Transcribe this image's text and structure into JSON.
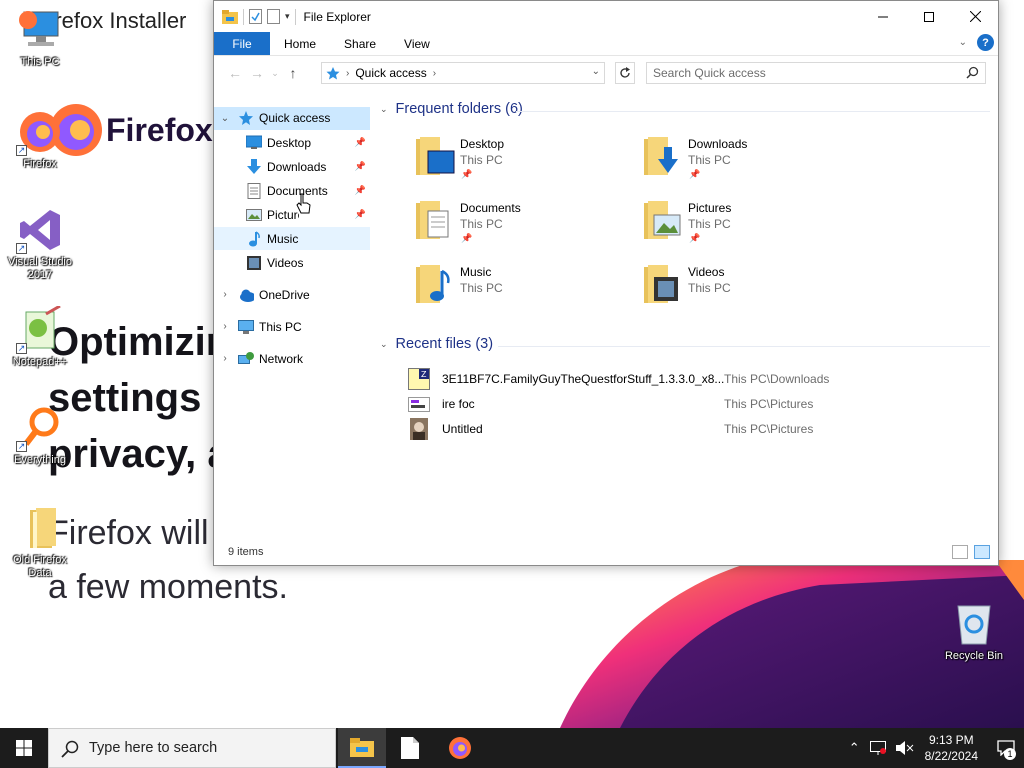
{
  "installer": {
    "title": "Firefox Installer",
    "brand": "Firefox B",
    "heading_lines": [
      "Optimizin",
      "settings fo",
      "privacy, a"
    ],
    "body_lines": [
      "Firefox will",
      "a few moments."
    ]
  },
  "desktop_icons": [
    {
      "label": "This PC",
      "icon": "this-pc-icon"
    },
    {
      "label": "Firefox",
      "icon": "firefox-icon"
    },
    {
      "label": "Visual Studio 2017",
      "icon": "visual-studio-icon"
    },
    {
      "label": "Notepad++",
      "icon": "notepadpp-icon"
    },
    {
      "label": "Everything",
      "icon": "everything-icon"
    },
    {
      "label": "Old Firefox Data",
      "icon": "folder-icon"
    },
    {
      "label": "Recycle Bin",
      "icon": "recycle-bin-icon"
    }
  ],
  "explorer": {
    "title": "File Explorer",
    "ribbon_tabs": [
      "File",
      "Home",
      "Share",
      "View"
    ],
    "help": "?",
    "address_crumb": "Quick access",
    "search_placeholder": "Search Quick access",
    "nav": [
      {
        "label": "Quick access",
        "icon": "star-icon",
        "selected": true
      },
      {
        "label": "Desktop",
        "icon": "desktop-icon",
        "pinned": true
      },
      {
        "label": "Downloads",
        "icon": "download-icon",
        "pinned": true
      },
      {
        "label": "Documents",
        "icon": "documents-icon",
        "pinned": true
      },
      {
        "label": "Pictures",
        "icon": "pictures-icon",
        "pinned": true
      },
      {
        "label": "Music",
        "icon": "music-icon",
        "hover": true
      },
      {
        "label": "Videos",
        "icon": "videos-icon"
      },
      {
        "label": "OneDrive",
        "icon": "onedrive-icon"
      },
      {
        "label": "This PC",
        "icon": "this-pc-icon"
      },
      {
        "label": "Network",
        "icon": "network-icon"
      }
    ],
    "frequent_header": "Frequent folders (6)",
    "frequent": [
      {
        "name": "Desktop",
        "location": "This PC",
        "pinned": true
      },
      {
        "name": "Downloads",
        "location": "This PC",
        "pinned": true
      },
      {
        "name": "Documents",
        "location": "This PC",
        "pinned": true
      },
      {
        "name": "Pictures",
        "location": "This PC",
        "pinned": true
      },
      {
        "name": "Music",
        "location": "This PC"
      },
      {
        "name": "Videos",
        "location": "This PC"
      }
    ],
    "recent_header": "Recent files (3)",
    "recent": [
      {
        "name": "3E11BF7C.FamilyGuyTheQuestforStuff_1.3.3.0_x8...",
        "location": "This PC\\Downloads"
      },
      {
        "name": "ire foc",
        "location": "This PC\\Pictures"
      },
      {
        "name": "Untitled",
        "location": "This PC\\Pictures"
      }
    ],
    "status": "9 items"
  },
  "taskbar": {
    "search_placeholder": "Type here to search",
    "time": "9:13 PM",
    "date": "8/22/2024",
    "notification_count": "1"
  },
  "colors": {
    "accent": "#1a6fc9",
    "group_header": "#1e3287",
    "selected_bg": "#cce8ff",
    "taskbar_bg": "#1c1c1c"
  }
}
